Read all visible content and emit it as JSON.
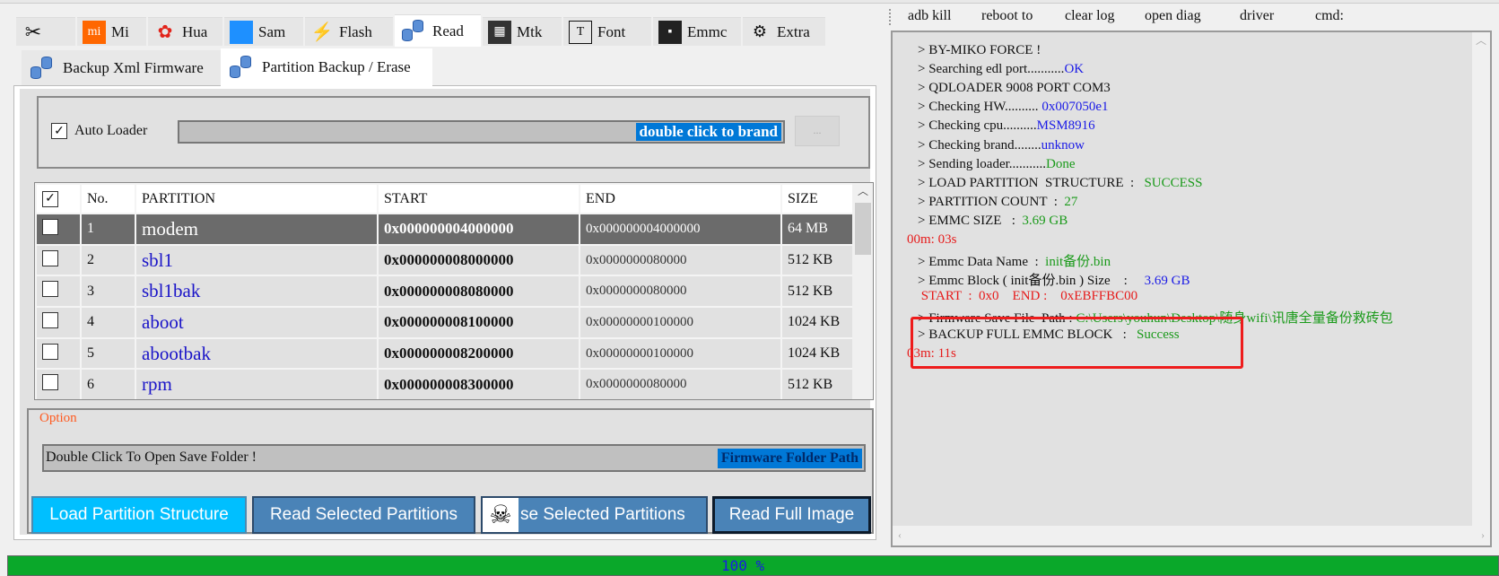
{
  "tabs": [
    {
      "label": "",
      "icon": "tools-icon"
    },
    {
      "label": "Mi",
      "icon": "xiaomi-icon"
    },
    {
      "label": "Hua",
      "icon": "huawei-icon"
    },
    {
      "label": "Sam",
      "icon": "samsung-icon"
    },
    {
      "label": "Flash",
      "icon": "lightning-icon"
    },
    {
      "label": "Read",
      "icon": "database-icon",
      "active": true
    },
    {
      "label": "Mtk",
      "icon": "chip-icon"
    },
    {
      "label": "Font",
      "icon": "font-file-icon"
    },
    {
      "label": "Emmc",
      "icon": "emmc-chip-icon"
    },
    {
      "label": "Extra",
      "icon": "extra-icon"
    }
  ],
  "subtabs": [
    {
      "label": "Backup Xml Firmware"
    },
    {
      "label": "Partition Backup / Erase",
      "active": true
    }
  ],
  "loader": {
    "auto_loader_label": "Auto Loader",
    "auto_loader_checked": true,
    "brand_text": "double click to brand",
    "browse_label": "..."
  },
  "table": {
    "headers": [
      "No.",
      "PARTITION",
      "START",
      "END",
      "SIZE"
    ],
    "rows": [
      {
        "no": "1",
        "name": "modem",
        "start": "0x000000004000000",
        "end": "0x000000004000000",
        "size": "64 MB",
        "selected": true
      },
      {
        "no": "2",
        "name": "sbl1",
        "start": "0x000000008000000",
        "end": "0x0000000080000",
        "size": "512 KB"
      },
      {
        "no": "3",
        "name": "sbl1bak",
        "start": "0x000000008080000",
        "end": "0x0000000080000",
        "size": "512 KB"
      },
      {
        "no": "4",
        "name": "aboot",
        "start": "0x000000008100000",
        "end": "0x00000000100000",
        "size": "1024 KB"
      },
      {
        "no": "5",
        "name": "abootbak",
        "start": "0x000000008200000",
        "end": "0x00000000100000",
        "size": "1024 KB"
      },
      {
        "no": "6",
        "name": "rpm",
        "start": "0x000000008300000",
        "end": "0x0000000080000",
        "size": "512 KB"
      }
    ]
  },
  "option": {
    "label": "Option",
    "folder_text": "Double Click To Open Save Folder !",
    "folder_button": "Firmware Folder Path"
  },
  "buttons": {
    "load": "Load Partition Structure",
    "read_selected": "Read Selected Partitions",
    "erase_selected": "se Selected Partitions",
    "read_full": "Read Full Image"
  },
  "toolbar": [
    "adb kill",
    "reboot to",
    "clear log",
    "open diag",
    "driver",
    "cmd:"
  ],
  "log": [
    [
      [
        "> BY-MIKO FORCE !",
        "#111"
      ]
    ],
    [
      [
        "> Searching edl port...........",
        "#111"
      ],
      [
        "OK",
        "#1a1ae6"
      ]
    ],
    [
      [
        "> QDLOADER 9008 PORT COM3",
        "#111"
      ]
    ],
    [
      [
        "> Checking HW.......... ",
        "#111"
      ],
      [
        "0x007050e1",
        "#1a1ae6"
      ]
    ],
    [
      [
        "> Checking cpu..........",
        "#111"
      ],
      [
        "MSM8916",
        "#1a1ae6"
      ]
    ],
    [
      [
        "> Checking brand........",
        "#111"
      ],
      [
        "unknow",
        "#1a1ae6"
      ]
    ],
    [
      [
        "> Sending loader...........",
        "#111"
      ],
      [
        "Done",
        "#1a9a1a"
      ]
    ],
    [
      [
        "> LOAD PARTITION  STRUCTURE  :   ",
        "#111"
      ],
      [
        "SUCCESS",
        "#1a9a1a"
      ]
    ],
    [
      [
        "> PARTITION COUNT  :  ",
        "#111"
      ],
      [
        "27",
        "#1a9a1a"
      ]
    ],
    [
      [
        "> EMMC SIZE   :  ",
        "#111"
      ],
      [
        "3.69 GB",
        "#1a9a1a"
      ]
    ],
    [
      [
        "00m: 03s",
        "#e61a1a"
      ]
    ],
    [
      [
        "> Emmc Data Name  :  ",
        "#111"
      ],
      [
        "init备份.bin",
        "#1a9a1a"
      ]
    ],
    [
      [
        "> Emmc Block ( init备份.bin ) Size    :     ",
        "#111"
      ],
      [
        "3.69 GB",
        "#1a1ae6"
      ]
    ],
    [
      [
        " START  :  0x0    END :    0xEBFFBC00",
        "#e61a1a"
      ]
    ],
    [
      [
        "> Firmware Save File  Path : ",
        "#111"
      ],
      [
        "C:\\Users\\youhun\\Desktop\\随身wifi\\讯唐全量备份救砖包",
        "#1a9a1a"
      ]
    ],
    [
      [
        "> BACKUP FULL EMMC BLOCK   :   ",
        "#111"
      ],
      [
        "Success",
        "#1a9a1a"
      ]
    ],
    [
      [
        "03m: 11s",
        "#e61a1a"
      ]
    ]
  ],
  "progress": {
    "value": 100,
    "label": "100 %"
  },
  "colors": {
    "progress": "#0aa82a",
    "highlight_box": "#ee1c1c",
    "brand_field": "#0078d7",
    "load_button": "#00bfff",
    "button": "#4a83b7"
  }
}
